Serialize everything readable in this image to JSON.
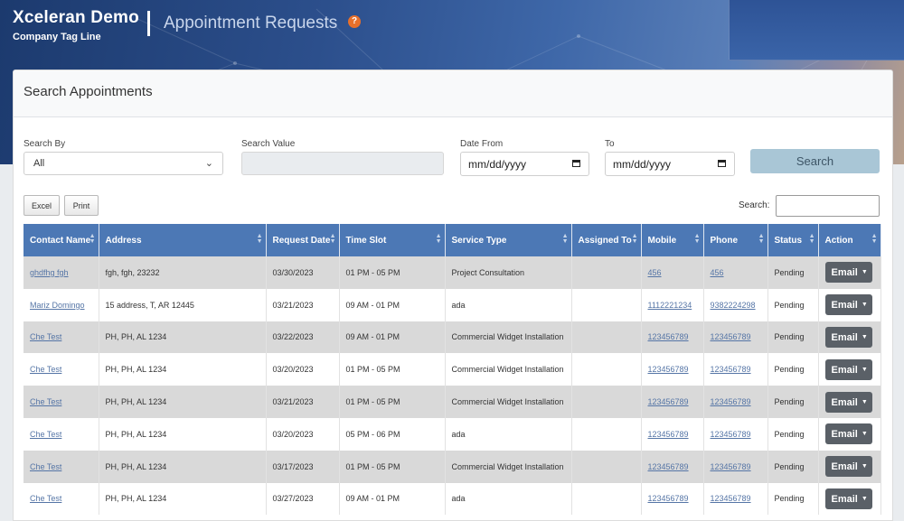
{
  "brand": {
    "title": "Xceleran Demo",
    "tagline": "Company Tag Line"
  },
  "page": {
    "heading": "Appointment Requests",
    "help_icon": "?"
  },
  "search_panel": {
    "title": "Search Appointments",
    "search_by_label": "Search By",
    "search_by_value": "All",
    "search_value_label": "Search Value",
    "search_value_value": "",
    "date_from_label": "Date From",
    "date_from_placeholder": "mm/dd/yyyy",
    "to_label": "To",
    "to_placeholder": "mm/dd/yyyy",
    "search_button": "Search"
  },
  "toolbar": {
    "excel_label": "Excel",
    "print_label": "Print",
    "search_label": "Search:"
  },
  "table": {
    "columns": [
      "Contact Name",
      "Address",
      "Request Date",
      "Time Slot",
      "Service Type",
      "Assigned To",
      "Mobile",
      "Phone",
      "Status",
      "Action"
    ],
    "rows": [
      {
        "contact": "ghdfhg fgh",
        "address": "fgh, fgh, 23232",
        "date": "03/30/2023",
        "slot": "01 PM - 05 PM",
        "service": "Project Consultation",
        "assigned": "",
        "mobile": "456",
        "phone": "456",
        "status": "Pending",
        "action": "Email"
      },
      {
        "contact": "Mariz Domingo",
        "address": "15 address, T, AR 12445",
        "date": "03/21/2023",
        "slot": "09 AM - 01 PM",
        "service": "ada",
        "assigned": "",
        "mobile": "1112221234",
        "phone": "9382224298",
        "status": "Pending",
        "action": "Email"
      },
      {
        "contact": "Che Test",
        "address": "PH, PH, AL 1234",
        "date": "03/22/2023",
        "slot": "09 AM - 01 PM",
        "service": "Commercial Widget Installation",
        "assigned": "",
        "mobile": "123456789",
        "phone": "123456789",
        "status": "Pending",
        "action": "Email"
      },
      {
        "contact": "Che Test",
        "address": "PH, PH, AL 1234",
        "date": "03/20/2023",
        "slot": "01 PM - 05 PM",
        "service": "Commercial Widget Installation",
        "assigned": "",
        "mobile": "123456789",
        "phone": "123456789",
        "status": "Pending",
        "action": "Email"
      },
      {
        "contact": "Che Test",
        "address": "PH, PH, AL 1234",
        "date": "03/21/2023",
        "slot": "01 PM - 05 PM",
        "service": "Commercial Widget Installation",
        "assigned": "",
        "mobile": "123456789",
        "phone": "123456789",
        "status": "Pending",
        "action": "Email"
      },
      {
        "contact": "Che Test",
        "address": "PH, PH, AL 1234",
        "date": "03/20/2023",
        "slot": "05 PM - 06 PM",
        "service": "ada",
        "assigned": "",
        "mobile": "123456789",
        "phone": "123456789",
        "status": "Pending",
        "action": "Email"
      },
      {
        "contact": "Che Test",
        "address": "PH, PH, AL 1234",
        "date": "03/17/2023",
        "slot": "01 PM - 05 PM",
        "service": "Commercial Widget Installation",
        "assigned": "",
        "mobile": "123456789",
        "phone": "123456789",
        "status": "Pending",
        "action": "Email"
      },
      {
        "contact": "Che Test",
        "address": "PH, PH, AL 1234",
        "date": "03/27/2023",
        "slot": "09 AM - 01 PM",
        "service": "ada",
        "assigned": "",
        "mobile": "123456789",
        "phone": "123456789",
        "status": "Pending",
        "action": "Email"
      }
    ]
  },
  "colors": {
    "header_blue": "#4c78b5",
    "row_gray": "#d9d9d9",
    "link": "#5575a6",
    "email_button": "#5a6067",
    "search_button": "#a9c6d6",
    "help_orange": "#e8702a"
  }
}
